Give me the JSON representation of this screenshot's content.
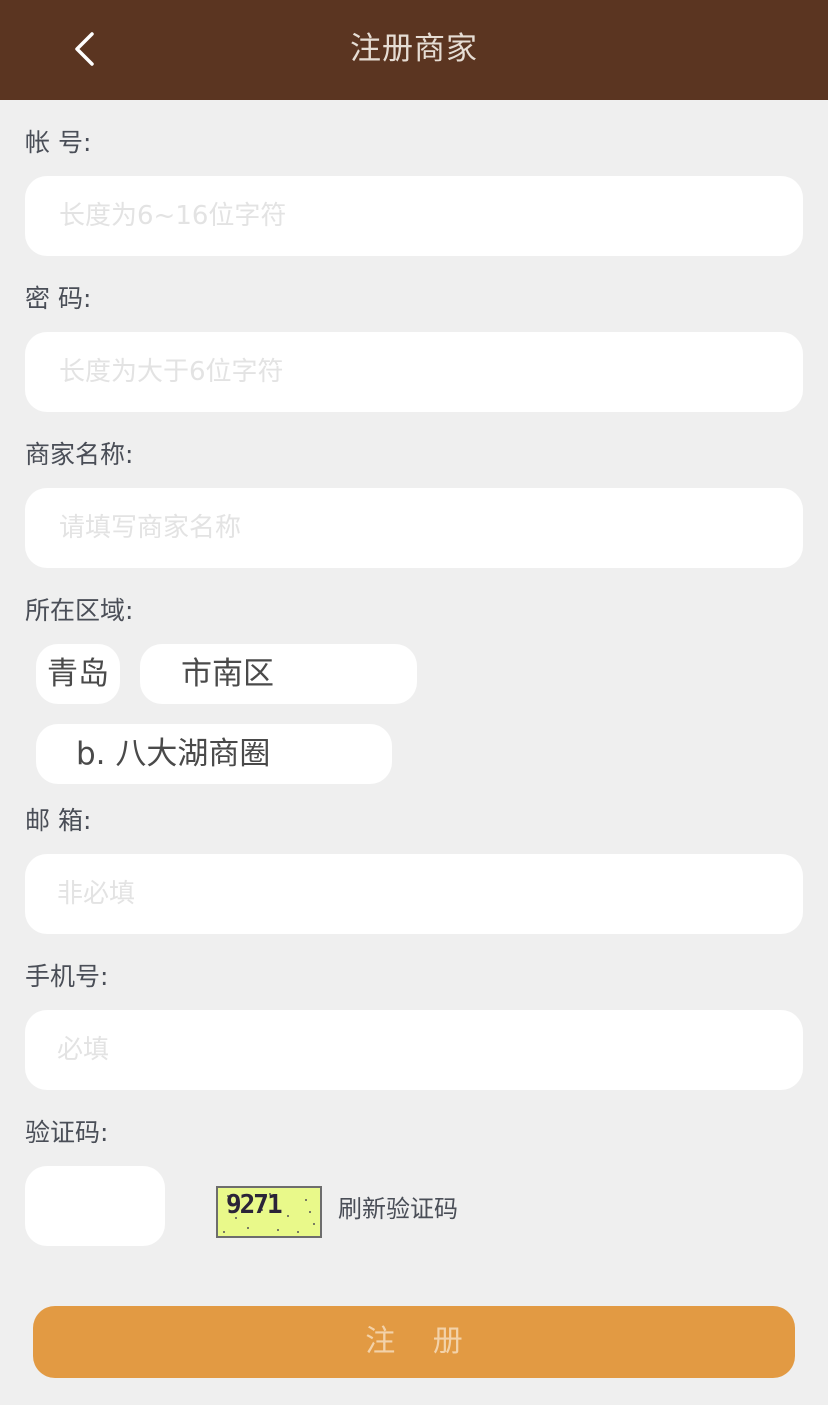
{
  "header": {
    "title": "注册商家",
    "back_icon": "chevron-left-icon",
    "background": "#5b3521"
  },
  "form": {
    "account": {
      "label": "帐  号:",
      "placeholder": "长度为6~16位字符"
    },
    "password": {
      "label": "密  码:",
      "placeholder": "长度为大于6位字符"
    },
    "merchant_name": {
      "label": "商家名称:",
      "placeholder": "请填写商家名称"
    },
    "region": {
      "label": "所在区域:",
      "city": "青岛",
      "district": "市南区",
      "business_area": "b. 八大湖商圈"
    },
    "email": {
      "label": "邮  箱:",
      "placeholder": "非必填"
    },
    "phone": {
      "label": "手机号:",
      "placeholder": "必填"
    },
    "captcha": {
      "label": "验证码:",
      "image_text": "9271",
      "refresh_label": "刷新验证码"
    }
  },
  "submit_label": "注 册",
  "colors": {
    "accent": "#e29a43",
    "page_bg": "#efefef"
  }
}
